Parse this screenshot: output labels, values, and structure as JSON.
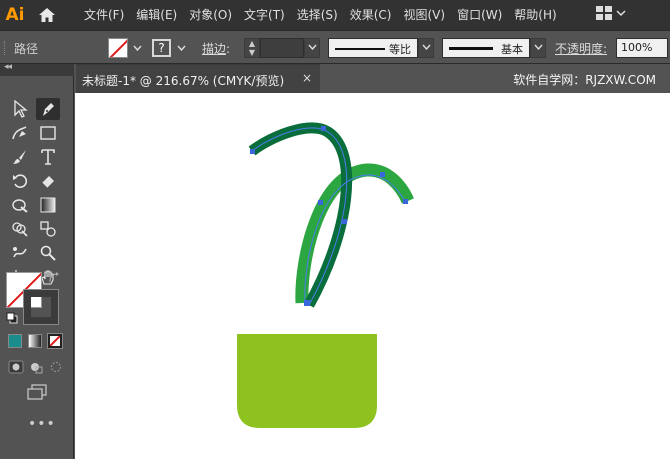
{
  "app": {
    "logo": "Ai"
  },
  "menubar": {
    "items": [
      "文件(F)",
      "编辑(E)",
      "对象(O)",
      "文字(T)",
      "选择(S)",
      "效果(C)",
      "视图(V)",
      "窗口(W)",
      "帮助(H)"
    ],
    "icons": [
      "home-icon",
      "workspace-grid-icon",
      "chevron-down-icon"
    ]
  },
  "controlbar": {
    "selection_label": "路径",
    "stroke_box": "?",
    "stroke_label": "描边",
    "stroke_label_colon": ":",
    "profile_label": "等比",
    "brush_label": "基本",
    "opacity_label": "不透明度",
    "opacity_colon": ":",
    "opacity_value": "100%"
  },
  "toolbox": {
    "collapse_glyph": "◂◂",
    "tools": [
      "selection-tool",
      "pen-tool",
      "curvature-tool",
      "rectangle-tool",
      "paintbrush-tool",
      "type-tool",
      "rotate-tool",
      "eraser-tool",
      "warp-tool",
      "gradient-tool",
      "shape-builder-tool",
      "blend-tool",
      "symbol-sprayer-tool",
      "zoom-tool",
      "artboard-tool",
      "hand-tool"
    ],
    "more": "•••"
  },
  "document": {
    "tab_title": "未标题-1* @ 216.67% (CMYK/预览)",
    "close": "×",
    "watermark": "软件自学网：RJZXW.COM"
  },
  "artwork": {
    "colors": {
      "pot": "#8dc21f",
      "leaf_dark": "#0a6e3c",
      "leaf_light": "#2ca640",
      "path_highlight": "#4a7df0",
      "selection_anchor": "#3a66d9"
    }
  }
}
